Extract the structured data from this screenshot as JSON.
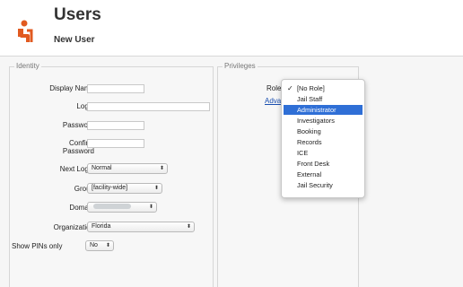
{
  "header": {
    "title": "Users",
    "subtitle": "New User",
    "logo_icon": "receptionist-icon",
    "accent": "#e15a20"
  },
  "identity": {
    "legend": "Identity",
    "display_name_label": "Display Name",
    "login_label": "Login",
    "password_label": "Password",
    "confirm_label_1": "Confirm",
    "confirm_label_2": "Password",
    "next_login_label": "Next Login",
    "next_login_value": "Normal",
    "group_label": "Group",
    "group_value": "[facility-wide]",
    "domain_label": "Domain",
    "organization_label": "Organization",
    "organization_value": "Florida",
    "show_pins_label": "Show PINs only",
    "show_pins_value": "No"
  },
  "privileges": {
    "legend": "Privileges",
    "role_label": "Role",
    "advanced_link": "Adva",
    "role_options": [
      "[No Role]",
      "Jail Staff",
      "Administrator",
      "Investigators",
      "Booking",
      "Records",
      "ICE",
      "Front Desk",
      "External",
      "Jail Security"
    ],
    "selected_option": "[No Role]",
    "highlighted_option": "Administrator",
    "highlight_color": "#2f6fd6"
  }
}
